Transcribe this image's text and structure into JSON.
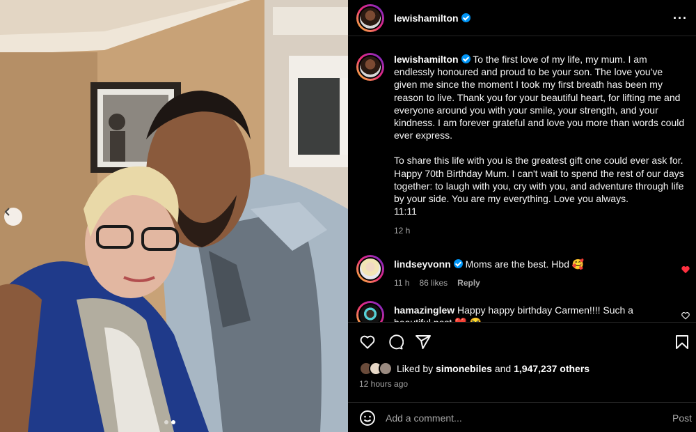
{
  "header": {
    "username": "lewishamilton",
    "more_label": "···"
  },
  "caption": {
    "username": "lewishamilton",
    "paragraph1": "To the first love of my life, my mum. I am endlessly honoured and proud to be your son. The love you've given me since the moment I took my first breath has been my reason to live. Thank you for your beautiful heart, for lifting me and everyone around you with your smile, your strength, and your kindness. I am forever grateful and love you more than words could ever express.",
    "paragraph2": "To share this life with you is the greatest gift one could ever ask for. Happy 70th Birthday Mum. I can't wait to spend the rest of our days together: to laugh with you, cry with you, and adventure through life by your side. You are my everything. Love you always.",
    "signoff": "11:11",
    "time": "12 h"
  },
  "comments": [
    {
      "username": "lindseyvonn",
      "text": "Moms are the best. Hbd 🥰",
      "time": "11 h",
      "likes": "86 likes",
      "reply": "Reply",
      "liked": true
    },
    {
      "username": "hamazinglew",
      "text": "Happy happy birthday Carmen!!!! Such a beautiful post ❤️ 😭",
      "liked": false
    }
  ],
  "likes": {
    "prefix": "Liked by",
    "user": "simonebiles",
    "middle": "and",
    "count": "1,947,237 others"
  },
  "posted_ago": "12 hours ago",
  "comment_input": {
    "placeholder": "Add a comment...",
    "post_label": "Post"
  },
  "colors": {
    "background": "#000000",
    "verified": "#0095f6",
    "liked_heart": "#ff3040",
    "muted_text": "#a8a8a8"
  },
  "carousel": {
    "total_slides": 2,
    "active_slide": 2
  },
  "icons": [
    "heart-icon",
    "comment-icon",
    "share-icon",
    "bookmark-icon",
    "emoji-icon",
    "more-icon",
    "chevron-left-icon",
    "verified-badge-icon"
  ]
}
